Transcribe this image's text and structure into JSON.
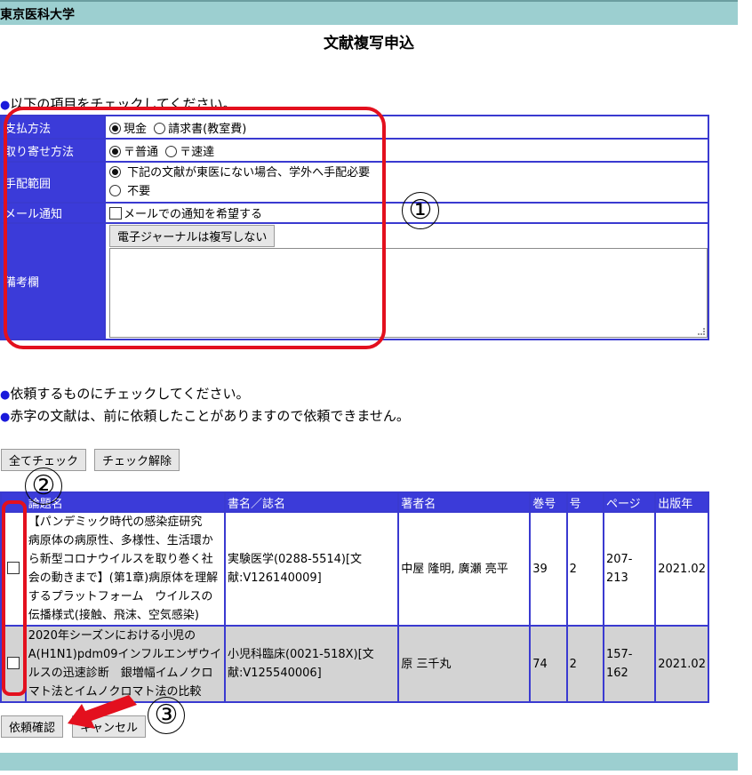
{
  "header": {
    "institution": "東京医科大学",
    "title": "文献複写申込"
  },
  "notes": {
    "check_items": "以下の項目をチェックしてください。",
    "select_items": "依頼するものにチェックしてください。",
    "red_warning": "赤字の文献は、前に依頼したことがありますので依頼できません。"
  },
  "form": {
    "payment": {
      "label": "支払方法",
      "opt1": "現金",
      "opt2": "請求書(教室費)"
    },
    "delivery": {
      "label": "取り寄せ方法",
      "opt1": "〒普通",
      "opt2": "〒速達"
    },
    "scope": {
      "label": "手配範囲",
      "opt1": "下記の文献が東医にない場合、学外へ手配必要",
      "opt2": "不要"
    },
    "mail": {
      "label": "メール通知",
      "opt": "メールでの通知を希望する"
    },
    "remarks": {
      "label": "備考欄",
      "button": "電子ジャーナルは複写しない",
      "value": ""
    }
  },
  "buttons": {
    "check_all": "全てチェック",
    "uncheck": "チェック解除",
    "confirm": "依頼確認",
    "cancel": "キャンセル"
  },
  "table": {
    "headers": [
      "論題名",
      "書名／誌名",
      "著者名",
      "巻号",
      "号",
      "ページ",
      "出版年"
    ],
    "rows": [
      {
        "title": "【パンデミック時代の感染症研究　病原体の病原性、多様性、生活環から新型コロナウイルスを取り巻く社会の動きまで】(第1章)病原体を理解するプラットフォーム　ウイルスの伝播様式(接触、飛沫、空気感染)",
        "journal": "実験医学(0288-5514)[文献:V126140009]",
        "authors": "中屋 隆明, 廣瀬 亮平",
        "volume": "39",
        "issue": "2",
        "pages": "207-213",
        "year": "2021.02"
      },
      {
        "title": "2020年シーズンにおける小児のA(H1N1)pdm09インフルエンザウイルスの迅速診断　銀増幅イムノクロマト法とイムノクロマト法の比較",
        "journal": "小児科臨床(0021-518X)[文献:V125540006]",
        "authors": "原 三千丸",
        "volume": "74",
        "issue": "2",
        "pages": "157-162",
        "year": "2021.02"
      }
    ]
  },
  "annotations": {
    "n1": "①",
    "n2": "②",
    "n3": "③"
  },
  "colors": {
    "header_bar": "#9ccfd0",
    "table_header": "#3b3bd9",
    "annotation_red": "#e3101e"
  }
}
